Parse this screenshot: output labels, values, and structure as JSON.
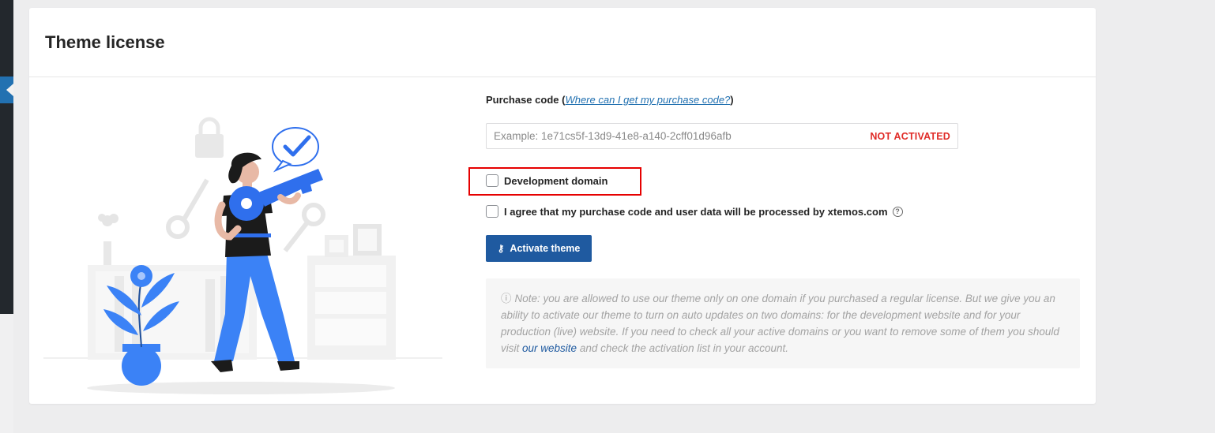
{
  "panel": {
    "title": "Theme license"
  },
  "form": {
    "purchase_code_label": "Purchase code",
    "purchase_code_help_link": "Where can I get my purchase code?",
    "purchase_code_placeholder": "Example: 1e71cs5f-13d9-41e8-a140-2cff01d96afb",
    "purchase_code_value": "",
    "status": "NOT ACTIVATED",
    "development_domain_label": "Development domain",
    "development_domain_checked": false,
    "agree_label": "I agree that my purchase code and user data will be processed by xtemos.com",
    "agree_checked": false,
    "help_icon": "?",
    "activate_button_label": "Activate theme",
    "activate_button_icon": "key-icon"
  },
  "note": {
    "before_link": "Note: you are allowed to use our theme only on one domain if you purchased a regular license. But we give you an ability to activate our theme to turn on auto updates on two domains: for the development website and for your production (live) website. If you need to check all your active domains or you want to remove some of them you should visit",
    "link_text": "our website",
    "after_link": "and check the activation list in your account."
  },
  "colors": {
    "accent": "#1f5aa0",
    "status_red": "#e02b27",
    "highlight_red": "#e60000",
    "illustration_blue": "#3b82f6"
  }
}
